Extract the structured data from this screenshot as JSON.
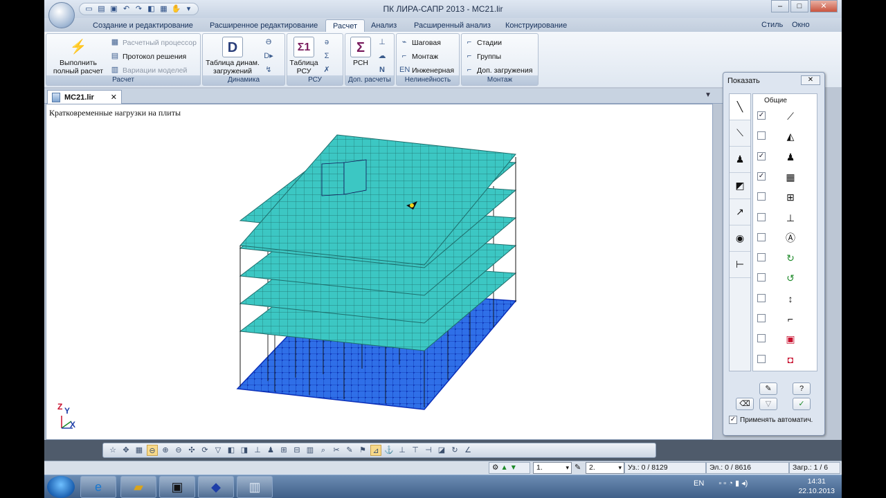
{
  "window": {
    "title": "ПК ЛИРА-САПР  2013 - МС21.lir",
    "buttons": {
      "minimize": "–",
      "maximize": "□",
      "close": "✕"
    }
  },
  "qat": {
    "icons": [
      "new-icon",
      "open-icon",
      "save-icon",
      "undo-icon",
      "redo-icon",
      "model-icon",
      "select-icon",
      "hand-icon"
    ]
  },
  "ribbon": {
    "tabs": [
      "Создание и редактирование",
      "Расширенное редактирование",
      "Расчет",
      "Анализ",
      "Расширенный анализ",
      "Конструирование"
    ],
    "active_tab": "Расчет",
    "right_menus": [
      "Стиль",
      "Окно"
    ],
    "groups": {
      "raschet": {
        "label": "Расчет",
        "run_label_1": "Выполнить",
        "run_label_2": "полный расчет",
        "processor": "Расчетный процессор",
        "protocol": "Протокол решения",
        "variations": "Вариации моделей"
      },
      "dynamics": {
        "label": "Динамика",
        "table_1": "Таблица динам.",
        "table_2": "загружений"
      },
      "rsu": {
        "label": "РСУ",
        "table_1": "Таблица",
        "table_2": "РСУ"
      },
      "dop": {
        "label": "Доп. расчеты",
        "rsn": "РСН"
      },
      "nonlin": {
        "label": "Нелинейность",
        "step": "Шаговая",
        "mount": "Монтаж",
        "eng": "Инженерная"
      },
      "montage": {
        "label": "Монтаж",
        "stages": "Стадии",
        "groups": "Группы",
        "extra_loads": "Доп. загружения"
      }
    }
  },
  "document": {
    "tab_label": "МС21.lir",
    "caption": "Кратковременные нагрузки на плиты",
    "axes": {
      "z": "Z",
      "y": "Y",
      "x": "X"
    }
  },
  "panel": {
    "title": "Показать",
    "list_header": "Общие",
    "items": [
      {
        "icon": "axes-icon",
        "checked": true
      },
      {
        "icon": "slab-icon",
        "checked": false
      },
      {
        "icon": "support-icon",
        "checked": true
      },
      {
        "icon": "mesh-icon",
        "checked": true
      },
      {
        "icon": "grid-frame-icon",
        "checked": false
      },
      {
        "icon": "dimension-icon",
        "checked": false
      },
      {
        "icon": "axis-label-icon",
        "checked": false
      },
      {
        "icon": "rotate-icon",
        "checked": false
      },
      {
        "icon": "rotate-local-icon",
        "checked": false
      },
      {
        "icon": "numbering-icon",
        "checked": false
      },
      {
        "icon": "frame-icon",
        "checked": false
      },
      {
        "icon": "red-box-icon",
        "checked": false
      },
      {
        "icon": "red-box-alt-icon",
        "checked": false
      }
    ],
    "auto_apply": "Применять автоматич.",
    "check_mark": "✓"
  },
  "statusbar": {
    "load_1": "1.",
    "load_2": "2.",
    "nodes": "Уз.: 0 / 8129",
    "elements": "Эл.: 0 / 8616",
    "loads": "Загр.: 1 / 6"
  },
  "taskbar": {
    "lang": "EN",
    "time": "14:31",
    "date": "22.10.2013"
  },
  "colors": {
    "slab": "#3cc7c3",
    "foundation": "#2f6fe8",
    "frame": "#111111"
  }
}
